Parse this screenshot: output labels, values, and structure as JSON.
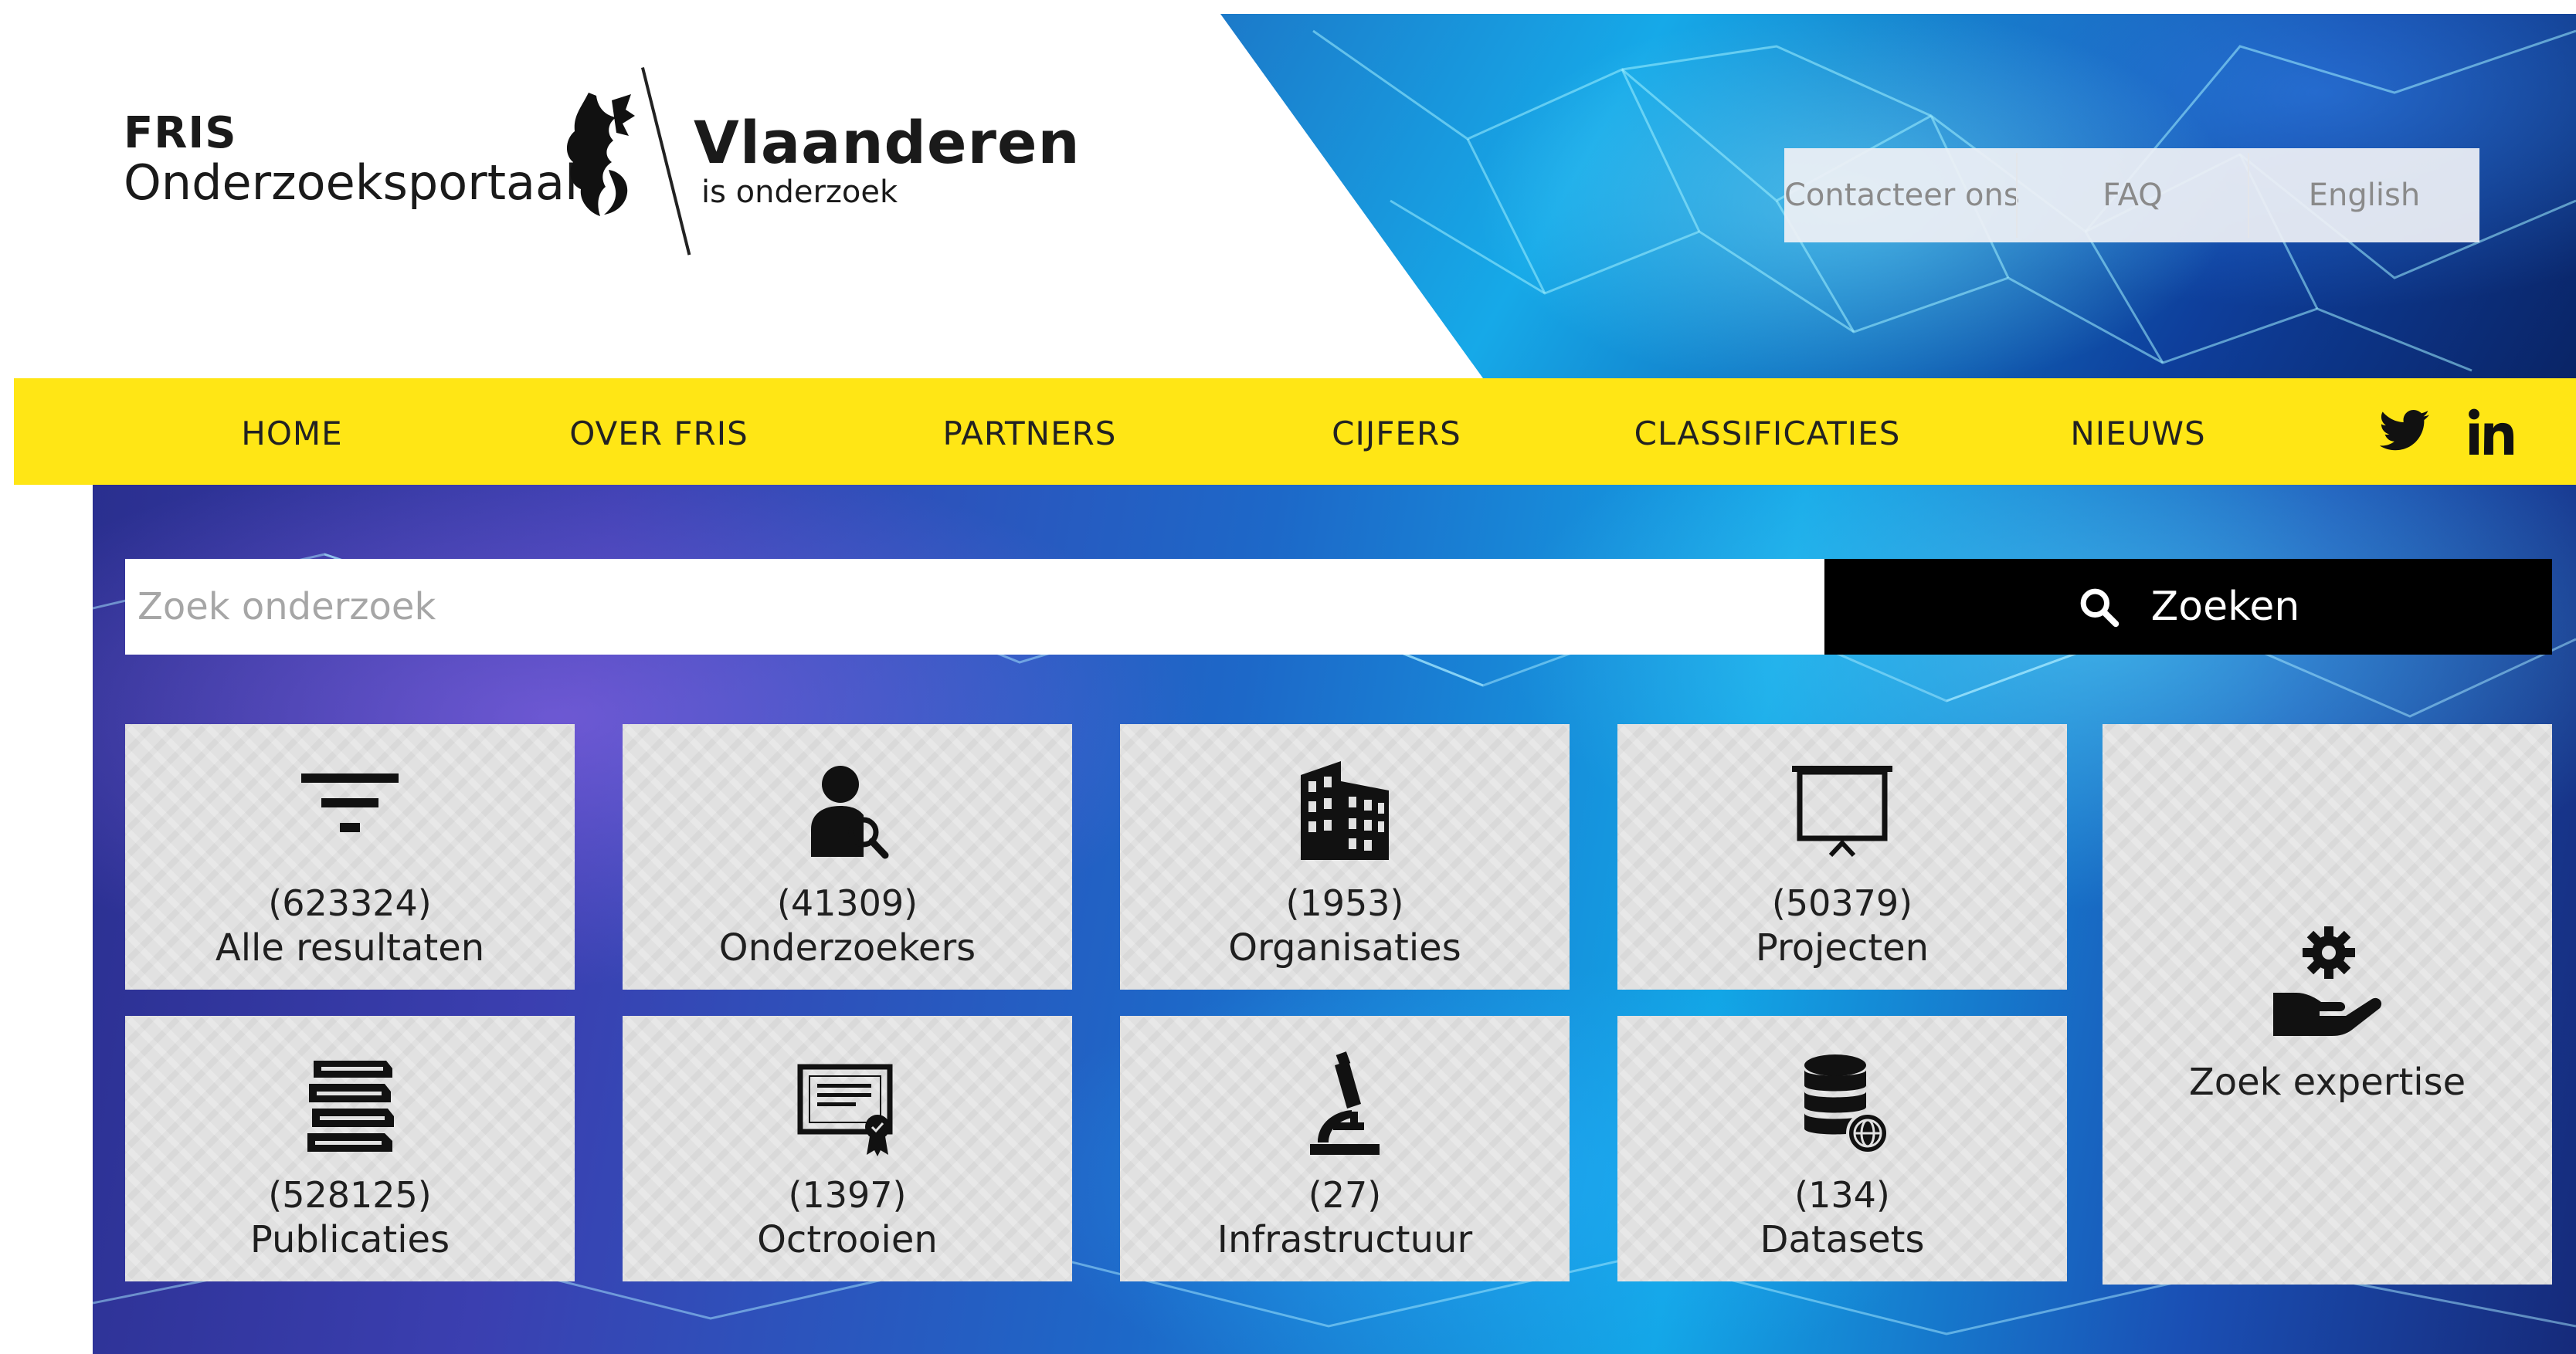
{
  "header": {
    "logo_line1": "FRIS",
    "logo_line2": "Onderzoeksportaal",
    "brand_name": "Vlaanderen",
    "brand_sub": "is onderzoek",
    "links": {
      "contact": "Contacteer ons",
      "faq": "FAQ",
      "english": "English"
    }
  },
  "nav": {
    "items": [
      "HOME",
      "OVER FRIS",
      "PARTNERS",
      "CIJFERS",
      "CLASSIFICATIES",
      "NIEUWS"
    ],
    "social": [
      "twitter-icon",
      "linkedin-icon"
    ]
  },
  "search": {
    "placeholder": "Zoek onderzoek",
    "button_label": "Zoeken"
  },
  "tiles": [
    {
      "count": "(623324)",
      "label": "Alle resultaten",
      "icon": "filter-icon"
    },
    {
      "count": "(41309)",
      "label": "Onderzoekers",
      "icon": "researcher-icon"
    },
    {
      "count": "(1953)",
      "label": "Organisaties",
      "icon": "building-icon"
    },
    {
      "count": "(50379)",
      "label": "Projecten",
      "icon": "presentation-icon"
    },
    {
      "count": "(528125)",
      "label": "Publicaties",
      "icon": "books-icon"
    },
    {
      "count": "(1397)",
      "label": "Octrooien",
      "icon": "certificate-icon"
    },
    {
      "count": "(27)",
      "label": "Infrastructuur",
      "icon": "microscope-icon"
    },
    {
      "count": "(134)",
      "label": "Datasets",
      "icon": "database-globe-icon"
    }
  ],
  "expertise": {
    "label": "Zoek expertise",
    "icon": "hand-gear-icon"
  },
  "colors": {
    "nav_yellow": "#ffe615",
    "button_black": "#000000",
    "tile_gray": "#e1e1e1"
  }
}
